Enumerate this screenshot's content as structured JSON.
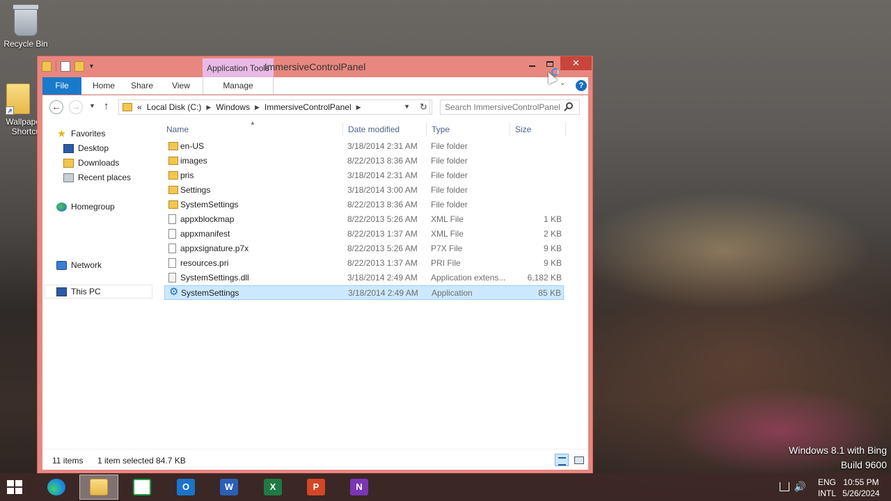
{
  "desktop": {
    "icons": [
      {
        "label": "Recycle Bin"
      },
      {
        "label": "Wallpaper\nShortcut",
        "label_line1": "Wallpape",
        "label_line2": "Shortcu"
      }
    ],
    "watermark": {
      "line1": "Windows 8.1 with Bing",
      "line2": "Build 9600"
    }
  },
  "window": {
    "title": "ImmersiveControlPanel",
    "context_tab": "Application Tools",
    "controls": {
      "minimize": "minimize",
      "maximize": "maximize",
      "close": "✕"
    }
  },
  "ribbon": {
    "tabs": {
      "file": "File",
      "home": "Home",
      "share": "Share",
      "view": "View",
      "manage": "Manage"
    },
    "help": "?"
  },
  "navbar": {
    "back": "←",
    "forward": "→",
    "up": "↑",
    "overflow": "«",
    "breadcrumb": [
      "Local Disk (C:)",
      "Windows",
      "ImmersiveControlPanel"
    ],
    "refresh": "↻",
    "search_placeholder": "Search ImmersiveControlPanel"
  },
  "navpane": {
    "favorites": "Favorites",
    "desktop": "Desktop",
    "downloads": "Downloads",
    "recent": "Recent places",
    "homegroup": "Homegroup",
    "thispc": "This PC",
    "network": "Network"
  },
  "list": {
    "columns": {
      "name": "Name",
      "date": "Date modified",
      "type": "Type",
      "size": "Size"
    },
    "rows": [
      {
        "icon": "folder-icon",
        "name": "en-US",
        "date": "3/18/2014 2:31 AM",
        "type": "File folder",
        "size": ""
      },
      {
        "icon": "folder-icon",
        "name": "images",
        "date": "8/22/2013 8:36 AM",
        "type": "File folder",
        "size": ""
      },
      {
        "icon": "folder-icon",
        "name": "pris",
        "date": "3/18/2014 2:31 AM",
        "type": "File folder",
        "size": ""
      },
      {
        "icon": "folder-icon",
        "name": "Settings",
        "date": "3/18/2014 3:00 AM",
        "type": "File folder",
        "size": ""
      },
      {
        "icon": "folder-icon",
        "name": "SystemSettings",
        "date": "8/22/2013 8:36 AM",
        "type": "File folder",
        "size": ""
      },
      {
        "icon": "file-icon",
        "name": "appxblockmap",
        "date": "8/22/2013 5:26 AM",
        "type": "XML File",
        "size": "1 KB"
      },
      {
        "icon": "file-icon",
        "name": "appxmanifest",
        "date": "8/22/2013 1:37 AM",
        "type": "XML File",
        "size": "2 KB"
      },
      {
        "icon": "file-icon",
        "name": "appxsignature.p7x",
        "date": "8/22/2013 5:26 AM",
        "type": "P7X File",
        "size": "9 KB"
      },
      {
        "icon": "file-icon",
        "name": "resources.pri",
        "date": "8/22/2013 1:37 AM",
        "type": "PRI File",
        "size": "9 KB"
      },
      {
        "icon": "dll-icon",
        "name": "SystemSettings.dll",
        "date": "3/18/2014 2:49 AM",
        "type": "Application extens...",
        "size": "6,182 KB"
      },
      {
        "icon": "gear-icon",
        "name": "SystemSettings",
        "date": "3/18/2014 2:49 AM",
        "type": "Application",
        "size": "85 KB",
        "selected": true
      }
    ]
  },
  "status": {
    "items": "11 items",
    "selected": "1 item selected  84.7 KB"
  },
  "taskbar": {
    "apps": [
      "edge-icon",
      "file-explorer-icon",
      "store-icon",
      "outlook-icon",
      "word-icon",
      "excel-icon",
      "powerpoint-icon",
      "onenote-icon"
    ],
    "app_letters": {
      "outlook": "O",
      "word": "W",
      "excel": "X",
      "ppt": "P",
      "onenote": "N"
    },
    "lang1": "ENG",
    "lang2": "INTL",
    "time": "10:55 PM",
    "date": "5/26/2024"
  },
  "colors": {
    "titlebar": "#e8877f",
    "close": "#c7453b",
    "file_tab": "#1979ca",
    "context_tab": "#e9b9e6",
    "selection": "#cce8ff"
  }
}
